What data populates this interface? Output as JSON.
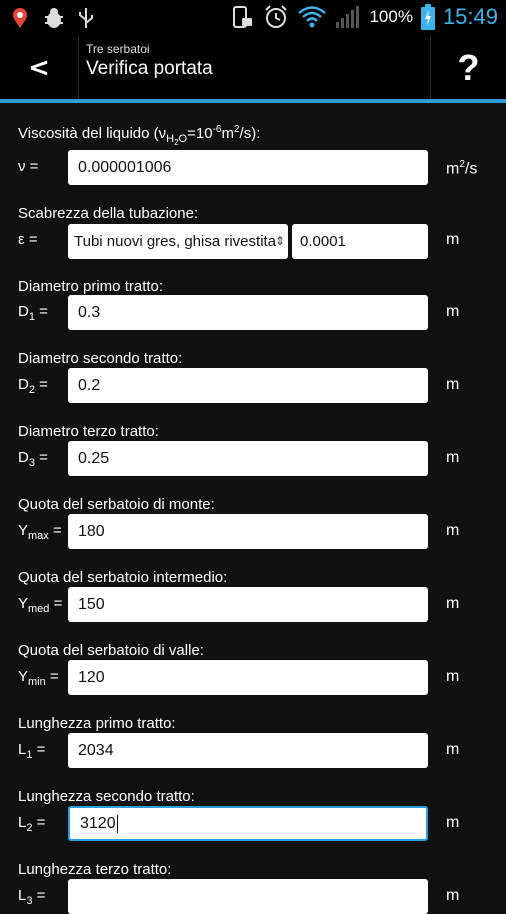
{
  "status": {
    "battery": "100%",
    "clock": "15:49"
  },
  "header": {
    "back": "<",
    "subtitle": "Tre serbatoi",
    "title": "Verifica portata",
    "help": "?"
  },
  "form": {
    "viscosity": {
      "label_pre": "Viscosità del liquido (",
      "label_nu": "ν",
      "label_sub": "H",
      "label_sub2": "2",
      "label_sub3": "O",
      "label_eq": "=10",
      "label_exp": "-6",
      "label_unit": "m",
      "label_unit_exp": "2",
      "label_post": "/s):",
      "symbol": "ν =",
      "value": "0.000001006",
      "unit_base": "m",
      "unit_exp": "2",
      "unit_post": "/s"
    },
    "roughness": {
      "label": "Scabrezza della tubazione:",
      "symbol": "ε =",
      "selected": "Tubi nuovi gres, ghisa rivestita",
      "value": "0.0001",
      "unit": "m"
    },
    "d1": {
      "label": "Diametro primo tratto:",
      "sym": "D",
      "sub": "1",
      "eq": " =",
      "value": "0.3",
      "unit": "m"
    },
    "d2": {
      "label": "Diametro secondo tratto:",
      "sym": "D",
      "sub": "2",
      "eq": " =",
      "value": "0.2",
      "unit": "m"
    },
    "d3": {
      "label": "Diametro terzo tratto:",
      "sym": "D",
      "sub": "3",
      "eq": " =",
      "value": "0.25",
      "unit": "m"
    },
    "ymax": {
      "label": "Quota del serbatoio di monte:",
      "sym": "Y",
      "sub": "max",
      "eq": " =",
      "value": "180",
      "unit": "m"
    },
    "ymed": {
      "label": "Quota del serbatoio intermedio:",
      "sym": "Y",
      "sub": "med",
      "eq": " =",
      "value": "150",
      "unit": "m"
    },
    "ymin": {
      "label": "Quota del serbatoio di valle:",
      "sym": "Y",
      "sub": "min",
      "eq": " =",
      "value": "120",
      "unit": "m"
    },
    "l1": {
      "label": "Lunghezza primo tratto:",
      "sym": "L",
      "sub": "1",
      "eq": " =",
      "value": "2034",
      "unit": "m"
    },
    "l2": {
      "label": "Lunghezza secondo tratto:",
      "sym": "L",
      "sub": "2",
      "eq": " =",
      "value": "3120",
      "unit": "m"
    },
    "l3": {
      "label": "Lunghezza terzo tratto:",
      "sym": "L",
      "sub": "3",
      "eq": " =",
      "value": "",
      "unit": "m"
    }
  }
}
